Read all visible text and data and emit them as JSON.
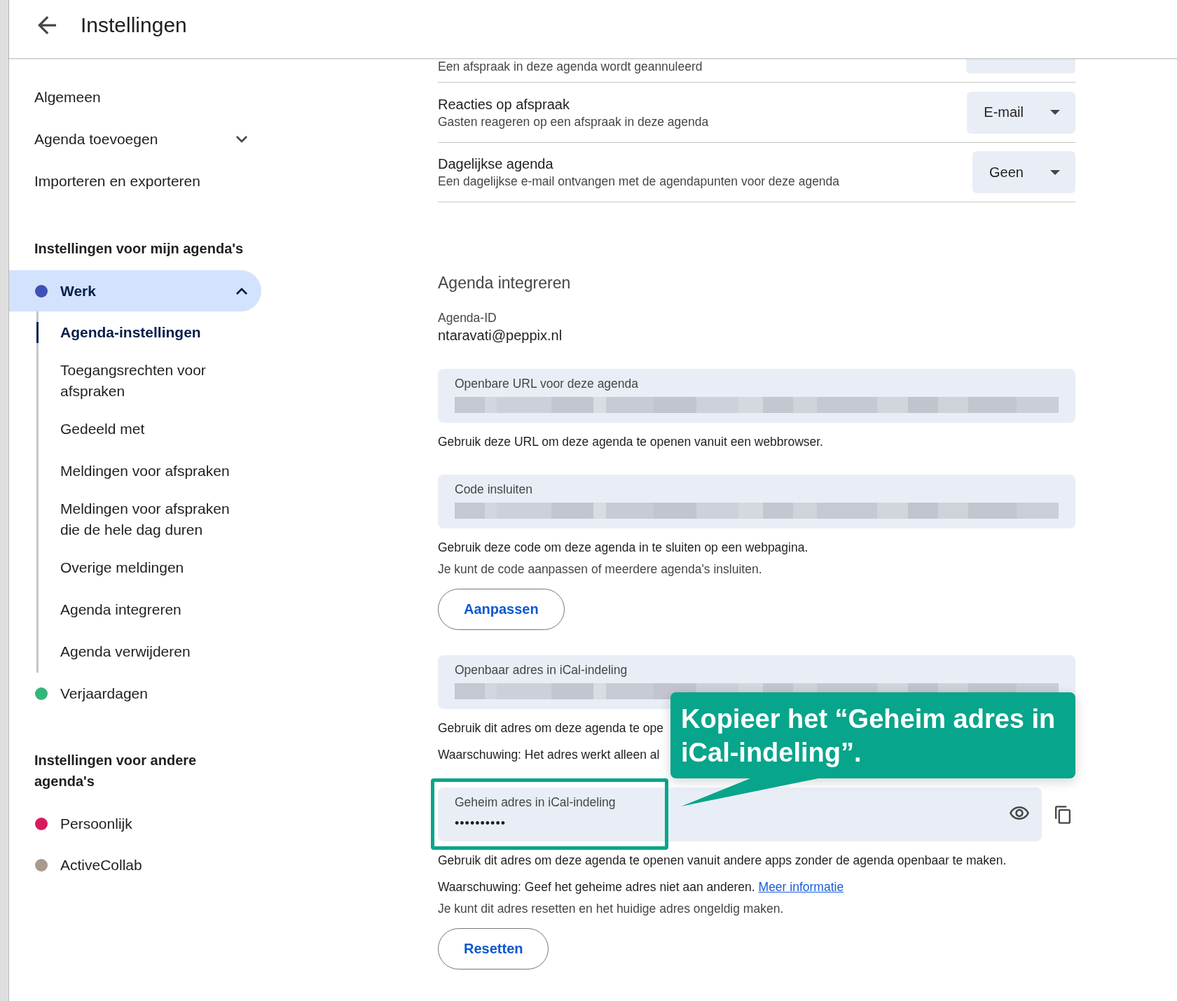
{
  "header": {
    "title": "Instellingen"
  },
  "sidebar": {
    "items": [
      {
        "label": "Algemeen",
        "kind": "link"
      },
      {
        "label": "Agenda toevoegen",
        "kind": "expander",
        "expanded": false
      },
      {
        "label": "Importeren en exporteren",
        "kind": "link"
      }
    ],
    "groups": [
      {
        "heading": "Instellingen voor mijn agenda's",
        "calendars": [
          {
            "name": "Werk",
            "color": "#3f51b5",
            "selected": true,
            "expanded": true,
            "children": [
              {
                "label": "Agenda-instellingen",
                "selected": true
              },
              {
                "label": "Toegangsrechten voor afspraken",
                "selected": false
              },
              {
                "label": "Gedeeld met",
                "selected": false
              },
              {
                "label": "Meldingen voor afspraken",
                "selected": false
              },
              {
                "label": "Meldingen voor afspraken die de hele dag duren",
                "selected": false
              },
              {
                "label": "Overige meldingen",
                "selected": false
              },
              {
                "label": "Agenda integreren",
                "selected": false
              },
              {
                "label": "Agenda verwijderen",
                "selected": false
              }
            ]
          },
          {
            "name": "Verjaardagen",
            "color": "#33b679",
            "selected": false,
            "expanded": false
          }
        ]
      },
      {
        "heading": "Instellingen voor andere agenda's",
        "calendars": [
          {
            "name": "Persoonlijk",
            "color": "#d81b60",
            "selected": false,
            "expanded": false
          },
          {
            "name": "ActiveCollab",
            "color": "#a79b8e",
            "selected": false,
            "expanded": false
          }
        ]
      }
    ]
  },
  "settings": {
    "rows": [
      {
        "kind": "clipped",
        "description": "Een afspraak in deze agenda wordt geannuleerd"
      },
      {
        "kind": "dropdown",
        "title": "Reacties op afspraak",
        "description": "Gasten reageren op een afspraak in deze agenda",
        "value": "E-mail"
      },
      {
        "kind": "dropdown",
        "title": "Dagelijkse agenda",
        "description": "Een dagelijkse e-mail ontvangen met de agendapunten voor deze agenda",
        "value": "Geen"
      }
    ]
  },
  "integration": {
    "heading": "Agenda integreren",
    "id_label": "Agenda-ID",
    "id_value": "ntaravati@peppix.nl",
    "fields": [
      {
        "kind": "redacted",
        "label": "Openbare URL voor deze agenda",
        "notes": [
          {
            "text": "Gebruik deze URL om deze agenda te openen vanuit een webbrowser.",
            "muted": false
          }
        ]
      },
      {
        "kind": "redacted",
        "label": "Code insluiten",
        "notes": [
          {
            "text": "Gebruik deze code om deze agenda in te sluiten op een webpagina.",
            "muted": false
          },
          {
            "text": "Je kunt de code aanpassen of meerdere agenda's insluiten.",
            "muted": true
          }
        ],
        "button": "Aanpassen"
      },
      {
        "kind": "redacted",
        "label": "Openbaar adres in iCal-indeling",
        "notes": [
          {
            "text": "Gebruik dit adres om deze agenda te ope",
            "muted": false
          },
          {
            "text": "Waarschuwing: Het adres werkt alleen al",
            "muted": false
          }
        ]
      },
      {
        "kind": "secret",
        "label": "Geheim adres in iCal-indeling",
        "value": "••••••••••",
        "highlighted": true,
        "callout": "Kopieer het “Geheim adres in iCal-indeling”.",
        "notes": [
          {
            "text": "Gebruik dit adres om deze agenda te openen vanuit andere apps zonder de agenda openbaar te maken.",
            "muted": false
          },
          {
            "text": "Waarschuwing: Geef het geheime adres niet aan anderen.",
            "link": "Meer informatie",
            "muted": false
          },
          {
            "text": "Je kunt dit adres resetten en het huidige adres ongeldig maken.",
            "muted": true
          }
        ],
        "button": "Resetten"
      }
    ]
  }
}
